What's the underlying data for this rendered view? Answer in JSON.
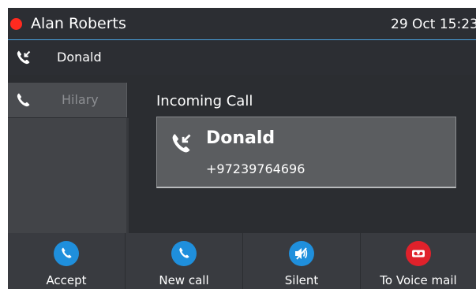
{
  "header": {
    "user_name": "Alan Roberts",
    "datetime": "29 Oct 15:23",
    "status_color": "#ff2a1f"
  },
  "calls": [
    {
      "name": "Donald",
      "icon": "incoming-call-icon",
      "state": "active"
    },
    {
      "name": "Hilary",
      "icon": "phone-icon",
      "state": "held"
    }
  ],
  "incoming": {
    "title": "Incoming Call",
    "caller_name": "Donald",
    "caller_number": "+97239764696",
    "icon": "incoming-call-icon"
  },
  "softkeys": [
    {
      "label": "Accept",
      "icon": "phone-icon",
      "color": "#1f8fdc"
    },
    {
      "label": "New call",
      "icon": "phone-icon",
      "color": "#1f8fdc"
    },
    {
      "label": "Silent",
      "icon": "speaker-muted-icon",
      "color": "#1f8fdc"
    },
    {
      "label": "To Voice mail",
      "icon": "voicemail-icon",
      "color": "#e0212b"
    }
  ]
}
